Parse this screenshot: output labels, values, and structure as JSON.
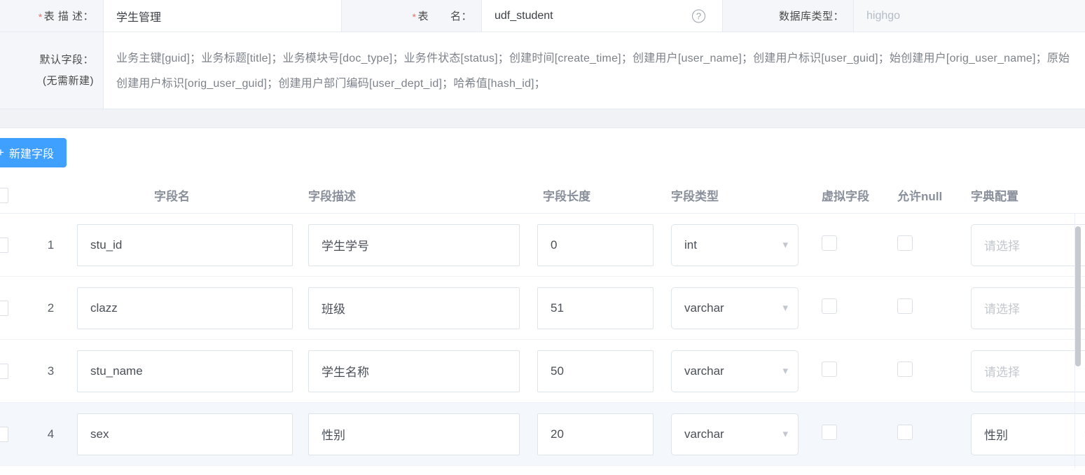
{
  "form": {
    "table_desc": {
      "label": "表 描 述：",
      "required": true,
      "value": "学生管理"
    },
    "table_name": {
      "label": "表　　名：",
      "required": true,
      "value": "udf_student",
      "help_icon": "help-circle-icon"
    },
    "db_type": {
      "label": "数据库类型：",
      "required": false,
      "value": "highgo",
      "disabled": true
    },
    "default_fields": {
      "label_line1": "默认字段：",
      "label_line2": "(无需新建)",
      "value": "业务主键[guid]；业务标题[title]；业务模块号[doc_type]；业务件状态[status]；创建时间[create_time]；创建用户[user_name]；创建用户标识[user_guid]；始创建用户[orig_user_name]；原始创建用户标识[orig_user_guid]；创建用户部门编码[user_dept_id]；哈希值[hash_id]；"
    }
  },
  "toolbar": {
    "add_field_label": "新建字段",
    "add_field_icon": "plus-icon",
    "primary_color": "#40a0ff"
  },
  "table": {
    "headers": {
      "select_all": "",
      "index": "",
      "field_name": "字段名",
      "field_desc": "字段描述",
      "field_length": "字段长度",
      "field_type": "字段类型",
      "virtual_field": "虚拟字段",
      "allow_null": "允许null",
      "dict_config": "字典配置"
    },
    "dict_placeholder": "请选择",
    "rows": [
      {
        "index": "1",
        "selected": false,
        "checked": false,
        "field_name": "stu_id",
        "field_desc": "学生学号",
        "field_length": "0",
        "field_type": "int",
        "virtual_field": false,
        "allow_null": false,
        "dict_config": "",
        "dict_is_placeholder": true
      },
      {
        "index": "2",
        "selected": false,
        "checked": false,
        "field_name": "clazz",
        "field_desc": "班级",
        "field_length": "51",
        "field_type": "varchar",
        "virtual_field": false,
        "allow_null": false,
        "dict_config": "",
        "dict_is_placeholder": true
      },
      {
        "index": "3",
        "selected": false,
        "checked": false,
        "field_name": "stu_name",
        "field_desc": "学生名称",
        "field_length": "50",
        "field_type": "varchar",
        "virtual_field": false,
        "allow_null": false,
        "dict_config": "",
        "dict_is_placeholder": true
      },
      {
        "index": "4",
        "selected": true,
        "checked": false,
        "field_name": "sex",
        "field_desc": "性别",
        "field_length": "20",
        "field_type": "varchar",
        "virtual_field": false,
        "allow_null": false,
        "dict_config": "性别",
        "dict_is_placeholder": false
      }
    ]
  }
}
